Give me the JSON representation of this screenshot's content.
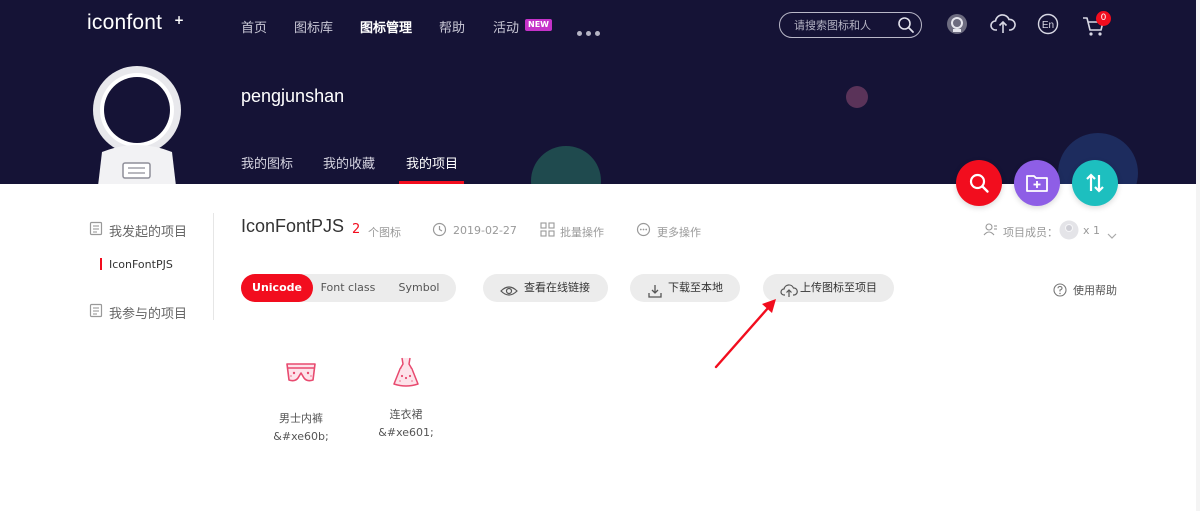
{
  "header": {
    "logo": "iconfont",
    "logo_plus": "+",
    "nav": [
      {
        "label": "首页"
      },
      {
        "label": "图标库"
      },
      {
        "label": "图标管理"
      },
      {
        "label": "帮助"
      },
      {
        "label": "活动"
      }
    ],
    "new_badge": "NEW",
    "search": {
      "placeholder": "请搜索图标和人"
    },
    "cart_count": "0",
    "lang_label": "En"
  },
  "profile": {
    "username": "pengjunshan",
    "tabs": [
      {
        "label": "我的图标"
      },
      {
        "label": "我的收藏"
      },
      {
        "label": "我的项目"
      }
    ]
  },
  "sidebar": {
    "my_projects": "我发起的项目",
    "project_item": "IconFontPJS",
    "joined_projects": "我参与的项目"
  },
  "project": {
    "name": "IconFontPJS",
    "count": "2",
    "count_unit": "个图标",
    "date": "2019-02-27",
    "batch": "批量操作",
    "more": "更多操作",
    "members_label": "项目成员：",
    "members_count": "x 1"
  },
  "toolbar": {
    "segments": [
      {
        "label": "Unicode"
      },
      {
        "label": "Font class"
      },
      {
        "label": "Symbol"
      }
    ],
    "view_link": "查看在线链接",
    "download": "下载至本地",
    "upload": "上传图标至项目",
    "help": "使用帮助"
  },
  "icons": [
    {
      "name": "男士内裤",
      "code": "&#xe60b;"
    },
    {
      "name": "连衣裙",
      "code": "&#xe601;"
    }
  ],
  "colors": {
    "header_bg": "#151336",
    "accent_red": "#f20d1e",
    "fab_purple": "#8e5ee6",
    "fab_teal": "#1dbfbf",
    "new_badge": "#c532c9"
  }
}
